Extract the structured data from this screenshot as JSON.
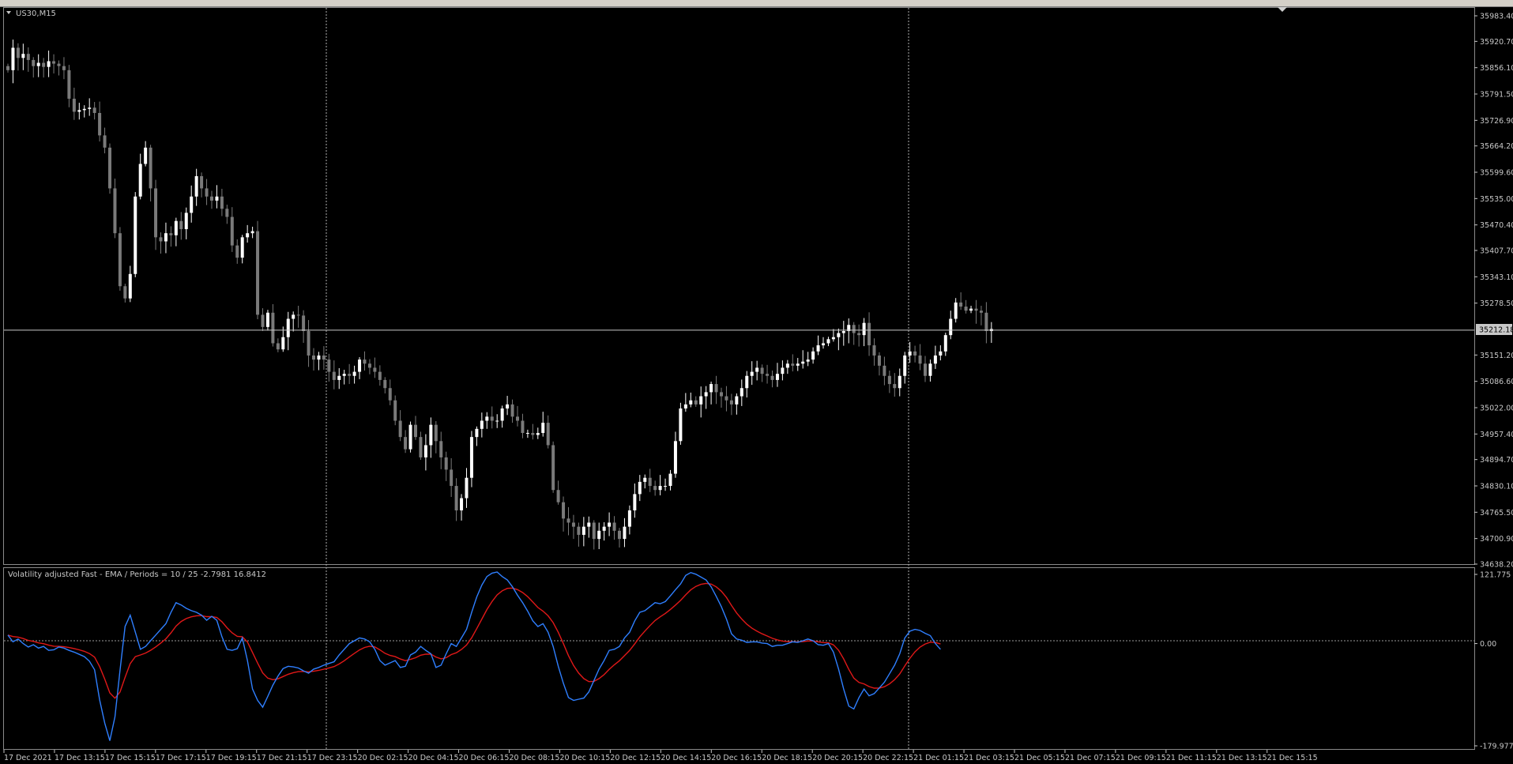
{
  "window": {
    "symbol_timeframe": "US30,M15"
  },
  "colors": {
    "background": "#000000",
    "bull_candle": "#ffffff",
    "bear_candle": "#7a7a7a",
    "bid_line": "#c8c8c8",
    "fast_line": "#2f7fff",
    "slow_line": "#e01818",
    "grid": "#c0c0c0"
  },
  "price_axis": {
    "labels": [
      "35983.40",
      "35920.70",
      "35856.10",
      "35791.50",
      "35726.90",
      "35664.20",
      "35599.60",
      "35535.00",
      "35470.40",
      "35407.70",
      "35343.10",
      "35278.50",
      "35151.20",
      "35086.60",
      "35022.00",
      "34957.40",
      "34894.70",
      "34830.10",
      "34765.50",
      "34700.90",
      "34638.20"
    ],
    "current_price": "35212.18",
    "range": [
      34638.2,
      35983.4
    ]
  },
  "indicator": {
    "title": "Volatility adjusted Fast - EMA / Periods = 10 / 25  -2.7981 16.8412",
    "axis_labels": [
      "121.775",
      "0.00",
      "-179.9771"
    ],
    "range": [
      -179.9771,
      121.775
    ]
  },
  "time_axis": {
    "labels": [
      "17 Dec 2021",
      "17 Dec 13:15",
      "17 Dec 15:15",
      "17 Dec 17:15",
      "17 Dec 19:15",
      "17 Dec 21:15",
      "17 Dec 23:15",
      "20 Dec 02:15",
      "20 Dec 04:15",
      "20 Dec 06:15",
      "20 Dec 08:15",
      "20 Dec 10:15",
      "20 Dec 12:15",
      "20 Dec 14:15",
      "20 Dec 16:15",
      "20 Dec 18:15",
      "20 Dec 20:15",
      "20 Dec 22:15",
      "21 Dec 01:15",
      "21 Dec 03:15",
      "21 Dec 05:15",
      "21 Dec 07:15",
      "21 Dec 09:15",
      "21 Dec 11:15",
      "21 Dec 13:15",
      "21 Dec 15:15"
    ]
  },
  "chart_data": {
    "type": "candlestick",
    "symbol": "US30",
    "timeframe": "M15",
    "closes": [
      35850,
      35905,
      35880,
      35890,
      35875,
      35860,
      35868,
      35858,
      35872,
      35866,
      35860,
      35850,
      35780,
      35748,
      35752,
      35755,
      35758,
      35745,
      35690,
      35660,
      35560,
      35450,
      35320,
      35290,
      35350,
      35540,
      35620,
      35660,
      35560,
      35440,
      35430,
      35450,
      35445,
      35480,
      35460,
      35500,
      35540,
      35590,
      35560,
      35540,
      35530,
      35540,
      35510,
      35490,
      35420,
      35390,
      35440,
      35450,
      35455,
      35250,
      35220,
      35255,
      35180,
      35165,
      35195,
      35240,
      35250,
      35248,
      35210,
      35150,
      35140,
      35150,
      35140,
      35110,
      35090,
      35100,
      35105,
      35100,
      35110,
      35140,
      35130,
      35120,
      35110,
      35090,
      35070,
      35040,
      34990,
      34950,
      34920,
      34980,
      34950,
      34900,
      34930,
      34980,
      34940,
      34900,
      34870,
      34830,
      34770,
      34800,
      34850,
      34950,
      34970,
      34990,
      35000,
      34990,
      34990,
      35020,
      35030,
      35000,
      34990,
      34960,
      34960,
      34955,
      34960,
      34985,
      34930,
      34820,
      34790,
      34750,
      34740,
      34730,
      34710,
      34730,
      34740,
      34700,
      34720,
      34730,
      34740,
      34720,
      34700,
      34730,
      34770,
      34810,
      34840,
      34850,
      34830,
      34820,
      34830,
      34830,
      34860,
      34940,
      35020,
      35030,
      35040,
      35030,
      35050,
      35060,
      35080,
      35060,
      35050,
      35040,
      35030,
      35050,
      35070,
      35100,
      35110,
      35120,
      35105,
      35100,
      35090,
      35105,
      35120,
      35130,
      35125,
      35130,
      35135,
      35140,
      35160,
      35175,
      35180,
      35190,
      35195,
      35205,
      35210,
      35225,
      35205,
      35200,
      35230,
      35175,
      35150,
      35125,
      35100,
      35080,
      35070,
      35100,
      35150,
      35160,
      35150,
      35130,
      35100,
      35130,
      35150,
      35160,
      35200,
      35240,
      35280,
      35270,
      35260,
      35265,
      35260,
      35255,
      35210,
      35215
    ]
  },
  "indicator_data": {
    "fast": [
      15,
      3,
      8,
      0,
      -6,
      -2,
      -8,
      -5,
      -12,
      -11,
      -6,
      -8,
      -12,
      -15,
      -19,
      -23,
      -31,
      -46,
      -99,
      -140,
      -171,
      -129,
      -47,
      30,
      50,
      20,
      -10,
      -5,
      5,
      15,
      25,
      35,
      55,
      72,
      68,
      62,
      58,
      55,
      50,
      41,
      48,
      41,
      12,
      -10,
      -12,
      -9,
      10,
      -30,
      -80,
      -100,
      -112,
      -93,
      -73,
      -57,
      -44,
      -40,
      -41,
      -43,
      -48,
      -52,
      -45,
      -42,
      -38,
      -35,
      -32,
      -20,
      -10,
      0,
      5,
      10,
      8,
      3,
      -10,
      -30,
      -38,
      -34,
      -30,
      -42,
      -40,
      -20,
      -15,
      -5,
      -12,
      -18,
      -42,
      -38,
      -18,
      0,
      -5,
      10,
      25,
      55,
      82,
      103,
      118,
      124,
      126,
      118,
      112,
      100,
      85,
      72,
      57,
      40,
      30,
      35,
      20,
      -5,
      -40,
      -70,
      -95,
      -100,
      -98,
      -96,
      -85,
      -65,
      -45,
      -30,
      -12,
      -10,
      -5,
      10,
      20,
      40,
      55,
      58,
      65,
      72,
      70,
      74,
      84,
      95,
      105,
      120,
      125,
      122,
      117,
      112,
      100,
      83,
      65,
      43,
      17,
      8,
      6,
      2,
      3,
      3,
      1,
      0,
      -5,
      -3,
      -3,
      0,
      3,
      2,
      5,
      8,
      5,
      -2,
      -3,
      0,
      -15,
      -45,
      -80,
      -110,
      -115,
      -95,
      -80,
      -92,
      -88,
      -78,
      -68,
      -53,
      -38,
      -18,
      10,
      22,
      25,
      23,
      18,
      14,
      0,
      -10
    ]
  }
}
